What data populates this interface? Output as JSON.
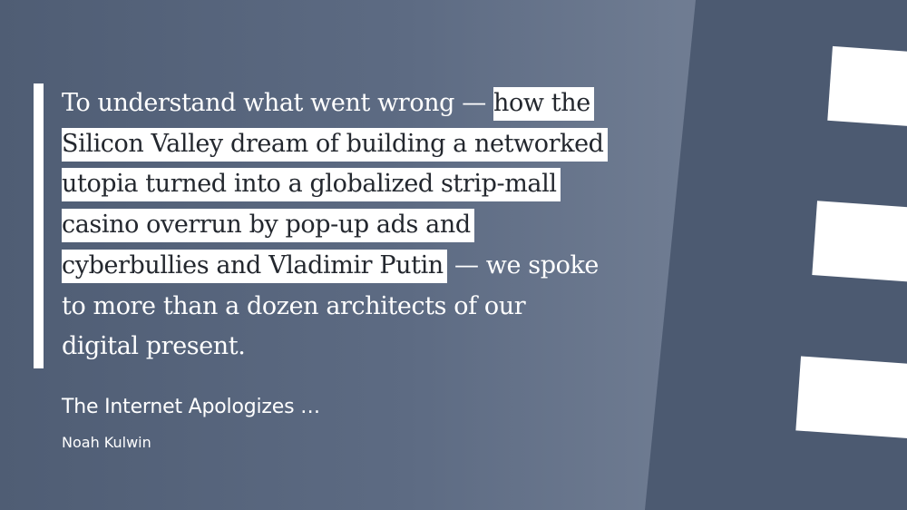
{
  "quote": {
    "text_before": "To understand what went wrong — ",
    "text_highlighted": "how the Silicon Valley dream of building a networked utopia turned into a globalized strip-mall casino overrun by pop-up ads and cyberbullies and Vladimir Putin",
    "text_after": " — we spoke to more than a dozen architects of our digital present."
  },
  "source": {
    "title": "The Internet Apologizes …",
    "author": "Noah Kulwin"
  },
  "colors": {
    "background_left": "#4f5d74",
    "background_right": "#778398",
    "panel": "#4c5a71",
    "highlight": "#ffffff",
    "highlight_text": "#23272e",
    "text": "#ffffff"
  }
}
